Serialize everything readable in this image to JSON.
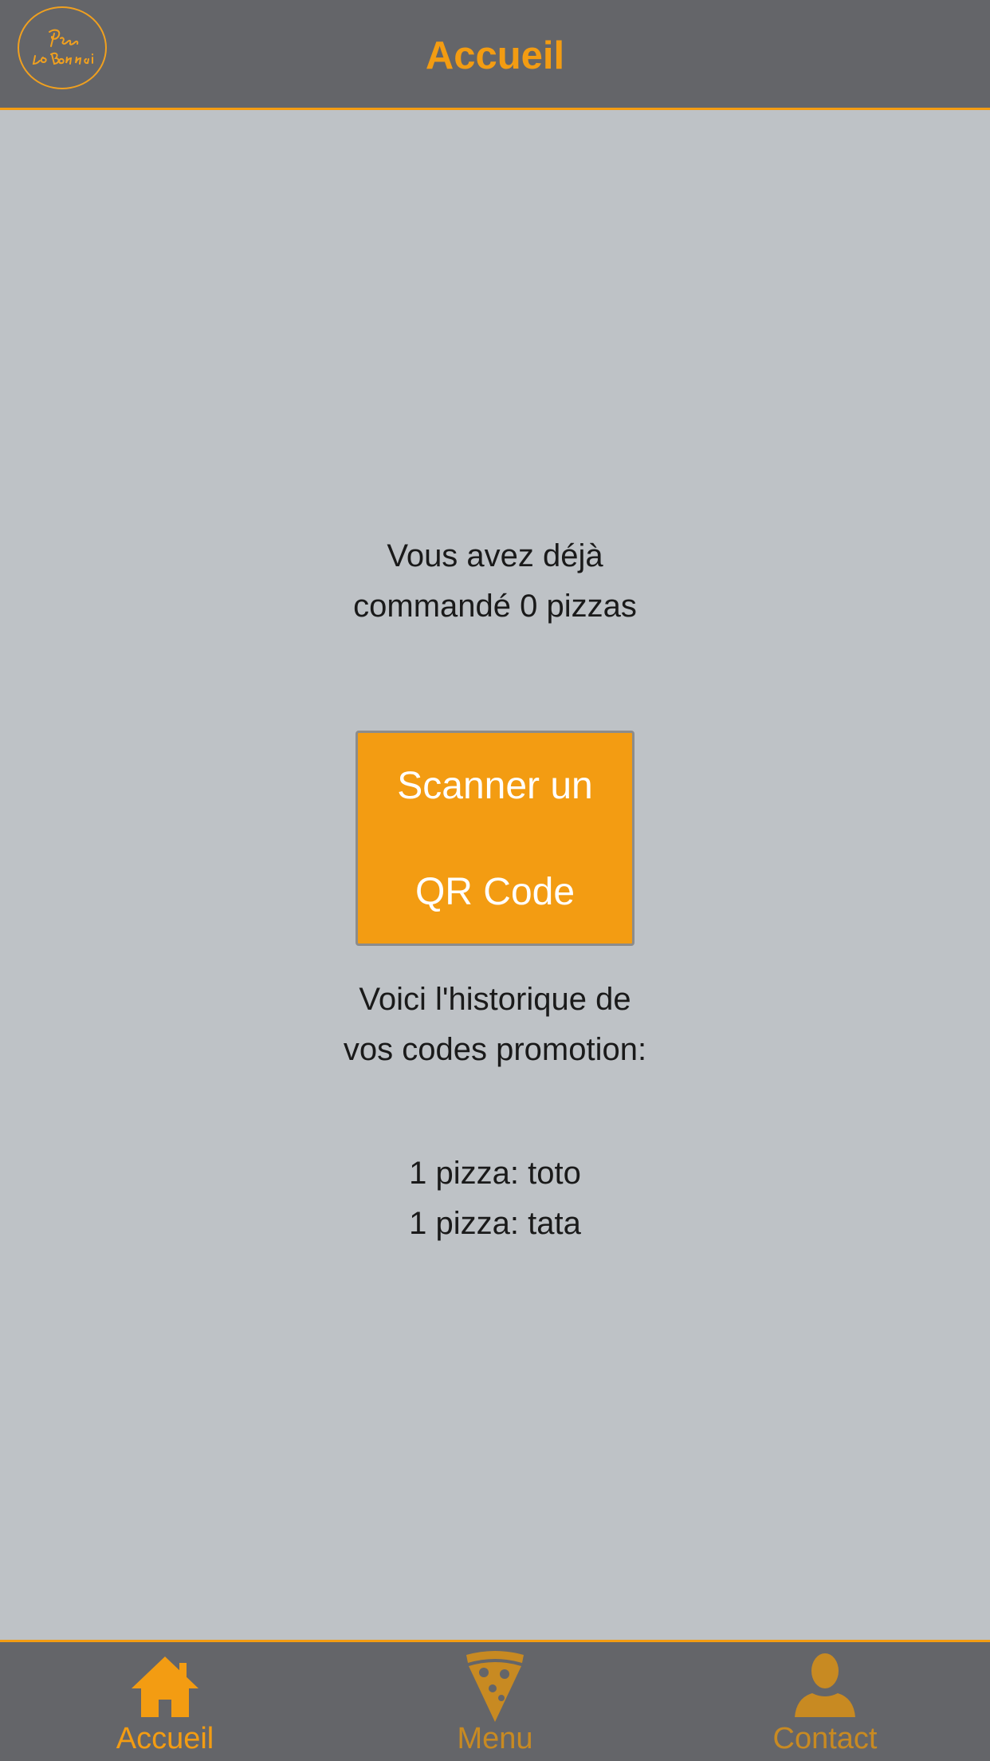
{
  "header": {
    "title": "Accueil",
    "logo_text": "Pizza la Bonnaine"
  },
  "main": {
    "ordered_text": "Vous avez déjà commandé 0 pizzas",
    "scan_button": {
      "line1": "Scanner un",
      "line2": "QR Code"
    },
    "history_intro": "Voici l'historique de vos codes promotion:",
    "promo_codes": [
      "1 pizza: toto",
      "1 pizza: tata"
    ]
  },
  "tabbar": {
    "tabs": [
      {
        "label": "Accueil",
        "icon": "home-icon",
        "active": true
      },
      {
        "label": "Menu",
        "icon": "pizza-slice-icon",
        "active": false
      },
      {
        "label": "Contact",
        "icon": "person-icon",
        "active": false
      }
    ]
  },
  "colors": {
    "accent": "#f39c12",
    "bar_background": "#646569",
    "page_background": "#bec2c6",
    "inactive_tab": "#c88a22"
  }
}
